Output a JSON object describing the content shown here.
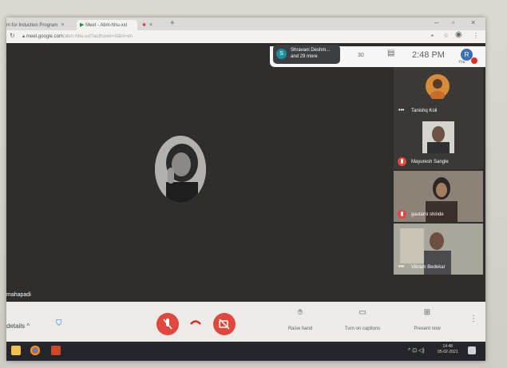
{
  "browser": {
    "tabs": [
      {
        "label": "m for Induction Program",
        "active": false
      },
      {
        "label": "Meet - Abm-hhu-xxl",
        "active": true
      }
    ],
    "tab3_label": "✱",
    "new_tab": "+",
    "controls": {
      "minimize": "–",
      "maximize": "▫",
      "close": "×"
    },
    "url_host": "meet.google.com",
    "url_path": "/abm-hhu-xxl?authuser=0&hl=en"
  },
  "meeting": {
    "participants_preview": {
      "initial": "S",
      "line1": "Shravani Deshm...",
      "line2": "and 29 more"
    },
    "people_count": "30",
    "time": "2:48 PM",
    "you": {
      "initial": "R",
      "label": "You"
    }
  },
  "main_speaker": {
    "name": "mahapadi"
  },
  "tiles": [
    {
      "name": "Tanishq Koli",
      "status": "more",
      "bg": "#3a3936"
    },
    {
      "name": "Mayuresh Sangle",
      "status": "muted",
      "bg": "#3a3936"
    },
    {
      "name": "gautami shinde",
      "status": "muted",
      "bg": "#6a6058"
    },
    {
      "name": "Vikram Bedekar",
      "status": "more",
      "bg": "#5e605c"
    }
  ],
  "tile_more_glyph": "•••",
  "controls_bar": {
    "details_label": "details",
    "details_chevron": "^",
    "raise_hand": "Raise hand",
    "captions": "Turn on captions",
    "present": "Present now",
    "more_icon": "⋮"
  },
  "taskbar": {
    "tray": "^ ⊡ ◁)",
    "time": "14:48",
    "date": "05-02-2021"
  }
}
